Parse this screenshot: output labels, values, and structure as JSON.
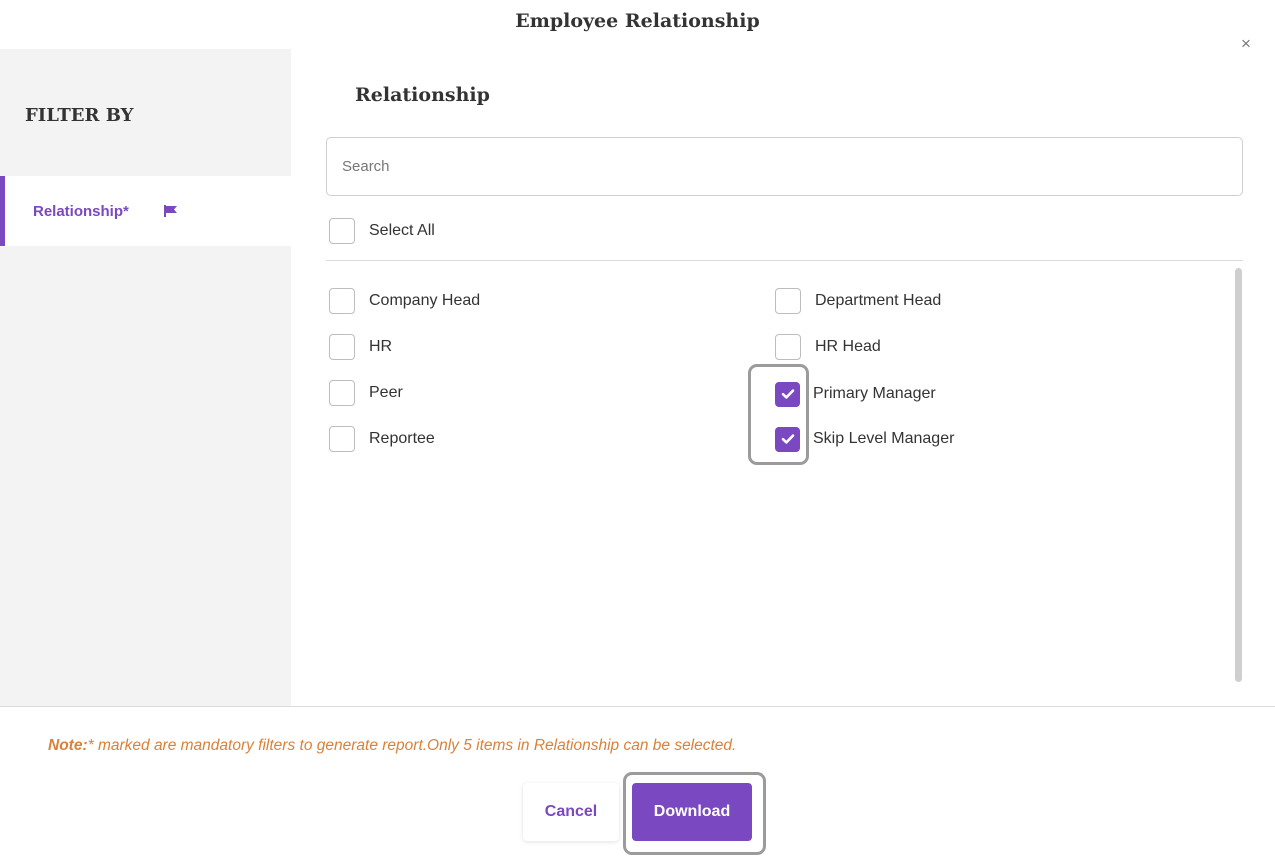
{
  "modal": {
    "title": "Employee Relationship",
    "close_symbol": "×"
  },
  "sidebar": {
    "heading": "FILTER BY",
    "items": [
      {
        "label": "Relationship*",
        "icon": "flag-icon",
        "active": true
      }
    ]
  },
  "main": {
    "section_title": "Relationship",
    "search_placeholder": "Search",
    "select_all_label": "Select All",
    "options": [
      {
        "label": "Company Head",
        "checked": false
      },
      {
        "label": "Department Head",
        "checked": false
      },
      {
        "label": "HR",
        "checked": false
      },
      {
        "label": "HR Head",
        "checked": false
      },
      {
        "label": "Peer",
        "checked": false
      },
      {
        "label": "Primary Manager",
        "checked": true
      },
      {
        "label": "Reportee",
        "checked": false
      },
      {
        "label": "Skip Level Manager",
        "checked": true
      }
    ]
  },
  "footer": {
    "note_prefix": "Note:",
    "note_text": "* marked are mandatory filters to generate report.Only 5 items in Relationship can be selected.",
    "cancel_label": "Cancel",
    "download_label": "Download"
  },
  "colors": {
    "accent": "#7a48c0",
    "note": "#d9813a",
    "sidebar_bg": "#f3f3f3"
  }
}
